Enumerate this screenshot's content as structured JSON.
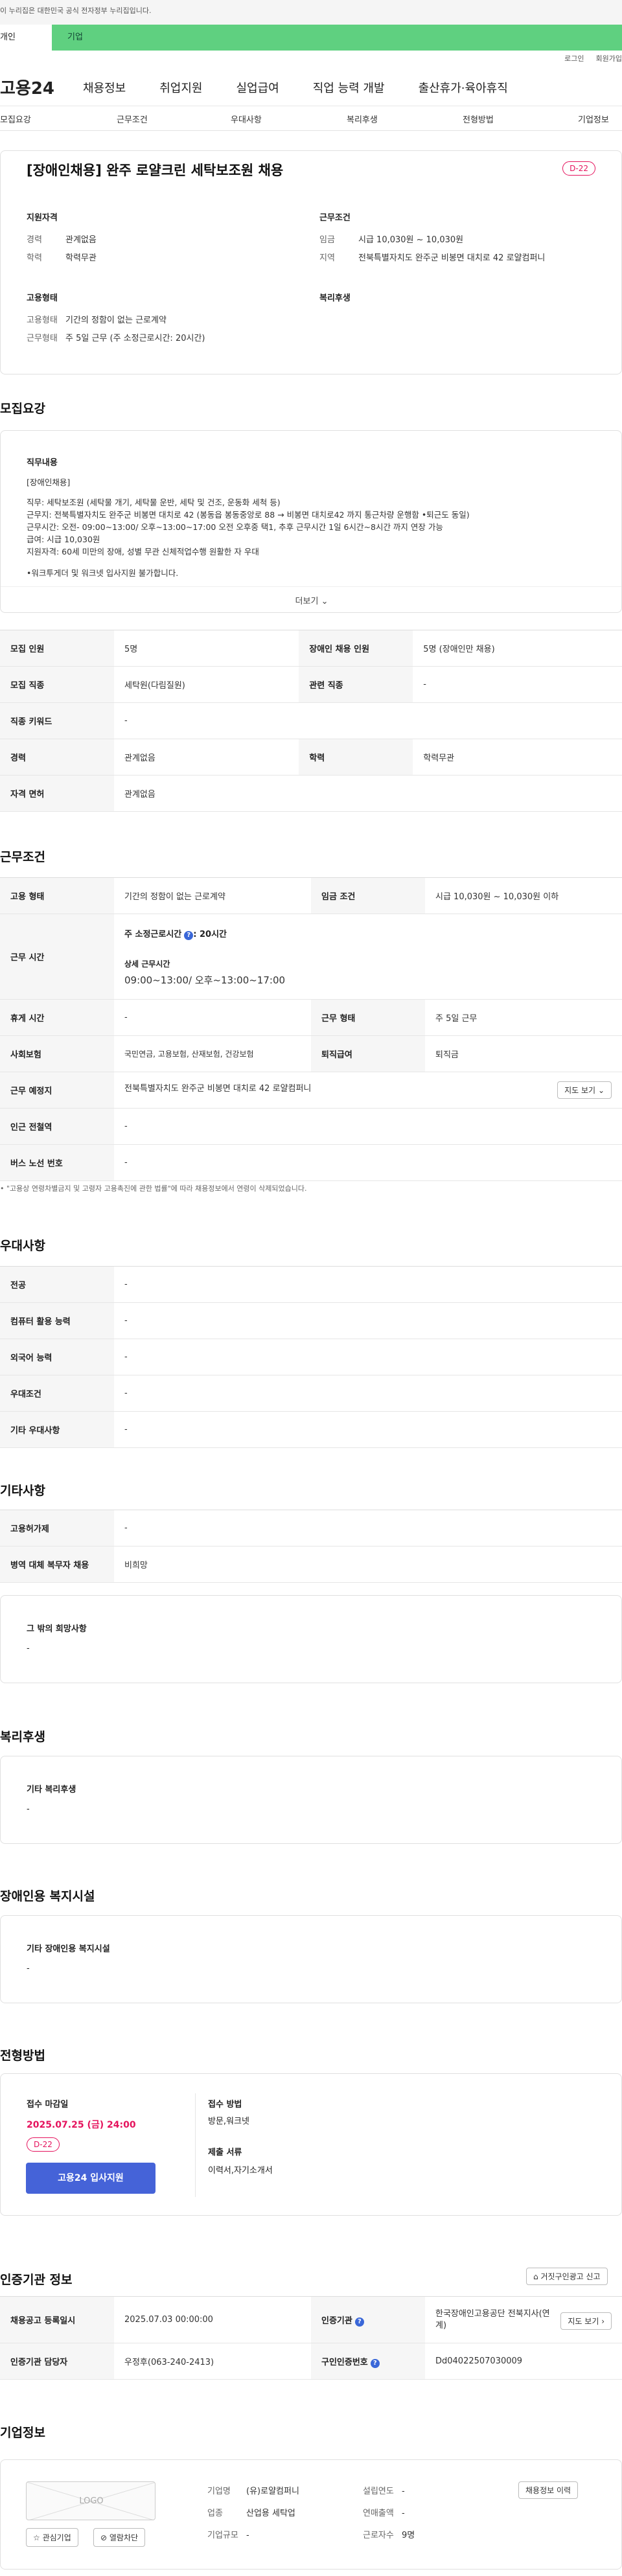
{
  "gov_banner": "이 누리집은 대한민국 공식 전자정부 누리집입니다.",
  "segment": {
    "left": "개인",
    "right": "기업"
  },
  "util": {
    "login": "로그인",
    "join": "회원가입"
  },
  "logo": "고용24",
  "gnb": [
    "채용정보",
    "취업지원",
    "실업급여",
    "직업 능력 개발",
    "출산휴가·육아휴직"
  ],
  "tabs": [
    "모집요강",
    "근무조건",
    "우대사항",
    "복리후생",
    "전형방법",
    "기업정보"
  ],
  "hero": {
    "title": "[장애인채용] 완주 로얄크린 세탁보조원 채용",
    "dday": "D-22",
    "qual_title": "지원자격",
    "career_k": "경력",
    "career_v": "관계없음",
    "edu_k": "학력",
    "edu_v": "학력무관",
    "cond_title": "근무조건",
    "wage_k": "임금",
    "wage_v": "시급 10,030원 ~ 10,030원",
    "area_k": "지역",
    "area_v": "전북특별자치도 완주군 비봉면 대치로 42 로얄컴퍼니",
    "emp_title": "고용형태",
    "type_k": "고용형태",
    "type_v": "기간의 정함이 없는 근로계약",
    "form_k": "근무형태",
    "form_v": "주 5일 근무 (주 소정근로시간: 20시간)",
    "welfare_title": "복리후생"
  },
  "recruit": {
    "heading": "모집요강",
    "job_title": "직무내용",
    "lines": [
      "[장애인채용]",
      "직무: 세탁보조원 (세탁물 개기, 세탁물 운반, 세탁 및 건조, 운동화 세척 등)",
      "근무지: 전북특별자치도 완주군 비봉면 대치로 42 (봉동읍 봉동중앙로 88 → 비봉면 대치로42 까지 통근차량 운행함 •퇴근도 동일)",
      "근무시간: 오전- 09:00~13:00/ 오후~13:00~17:00 오전 오후중 택1, 추후 근무시간 1일 6시간~8시간 까지 연장 가능",
      "급여: 시급 10,030원",
      "지원자격: 60세 미만의 장애, 성별 무관 신체적업수행 원활한 자 우대",
      "",
      "•워크투게더 및 워크넷 입사지원 불가합니다."
    ],
    "more": "더보기",
    "table": [
      [
        "모집 인원",
        "5명",
        "장애인 채용 인원",
        "5명 (장애인만 채용)"
      ],
      [
        "모집 직종",
        "세탁원(다림질원)",
        "관련 직종",
        "-"
      ],
      [
        "직종 키워드",
        "-"
      ],
      [
        "경력",
        "관계없음",
        "학력",
        "학력무관"
      ],
      [
        "자격 면허",
        "관계없음"
      ]
    ]
  },
  "work": {
    "heading": "근무조건",
    "type_k": "고용 형태",
    "type_v": "기간의 정함이 없는 근로계약",
    "wage_k": "임금 조건",
    "wage_v": "시급 10,030원 ~ 10,030원 이하",
    "hours_k": "근무 시간",
    "hours_main": "주 소정근로시간",
    "hours_val": ": 20시간",
    "hours_detail_t": "상세 근무시간",
    "hours_detail_v": "09:00~13:00/ 오후~13:00~17:00",
    "rest_k": "휴게 시간",
    "rest_v": "-",
    "form_k": "근무 형태",
    "form_v": "주 5일 근무",
    "ins_k": "사회보험",
    "ins_v": "국민연금, 고용보험, 산재보험, 건강보험",
    "sev_k": "퇴직급여",
    "sev_v": "퇴직금",
    "place_k": "근무 예정지",
    "place_v": "전북특별자치도 완주군 비봉면 대치로 42 로얄컴퍼니",
    "map_btn": "지도 보기",
    "sub_k": "인근 전철역",
    "sub_v": "-",
    "bus_k": "버스 노선 번호",
    "bus_v": "-",
    "note": "\"고용상 연령차별금지 및 고령자 고용촉진에 관한 법률\"에 따라 채용정보에서 연령이 삭제되었습니다."
  },
  "pref": {
    "heading": "우대사항",
    "rows": [
      [
        "전공",
        "-"
      ],
      [
        "컴퓨터 활용 능력",
        "-"
      ],
      [
        "외국어 능력",
        "-"
      ],
      [
        "우대조건",
        "-"
      ],
      [
        "기타 우대사항",
        "-"
      ]
    ]
  },
  "etc": {
    "heading": "기타사항",
    "rows": [
      [
        "고용허가제",
        "-"
      ],
      [
        "병역 대체 복무자 채용",
        "비희망"
      ]
    ],
    "box_t": "그 밖의 희망사항",
    "box_v": "-"
  },
  "welfare": {
    "heading": "복리후생",
    "box_t": "기타 복리후생",
    "box_v": "-"
  },
  "disab": {
    "heading": "장애인용 복지시설",
    "box_t": "기타 장애인용 복지시설",
    "box_v": "-"
  },
  "process": {
    "heading": "전형방법",
    "deadline_t": "접수 마감일",
    "deadline_v": "2025.07.25 (금) 24:00",
    "dday": "D-22",
    "apply": "고용24 입사지원",
    "method_t": "접수 방법",
    "method_v": "방문,워크넷",
    "docs_t": "제출 서류",
    "docs_v": "이력서,자기소개서"
  },
  "auth": {
    "heading": "인증기관 정보",
    "report": "거짓구인광고 신고",
    "reg_k": "채용공고 등록일시",
    "reg_v": "2025.07.03 00:00:00",
    "org_k": "인증기관",
    "org_v": "한국장애인고용공단 전북지사(연계)",
    "org_btn": "지도 보기",
    "mgr_k": "인증기관 담당자",
    "mgr_v": "우정후(063-240-2413)",
    "no_k": "구인인증번호",
    "no_v": "Dd04022507030009"
  },
  "company": {
    "heading": "기업정보",
    "logo": "LOGO",
    "name_k": "기업명",
    "name_v": "(유)로얄컴퍼니",
    "year_k": "설립연도",
    "year_v": "-",
    "biz_k": "업종",
    "biz_v": "산업용 세탁업",
    "sales_k": "연매출액",
    "sales_v": "-",
    "size_k": "기업규모",
    "size_v": "-",
    "emp_k": "근로자수",
    "emp_v": "9명",
    "history_btn": "채용정보 이력",
    "fav": "관심기업",
    "block": "열람차단"
  }
}
